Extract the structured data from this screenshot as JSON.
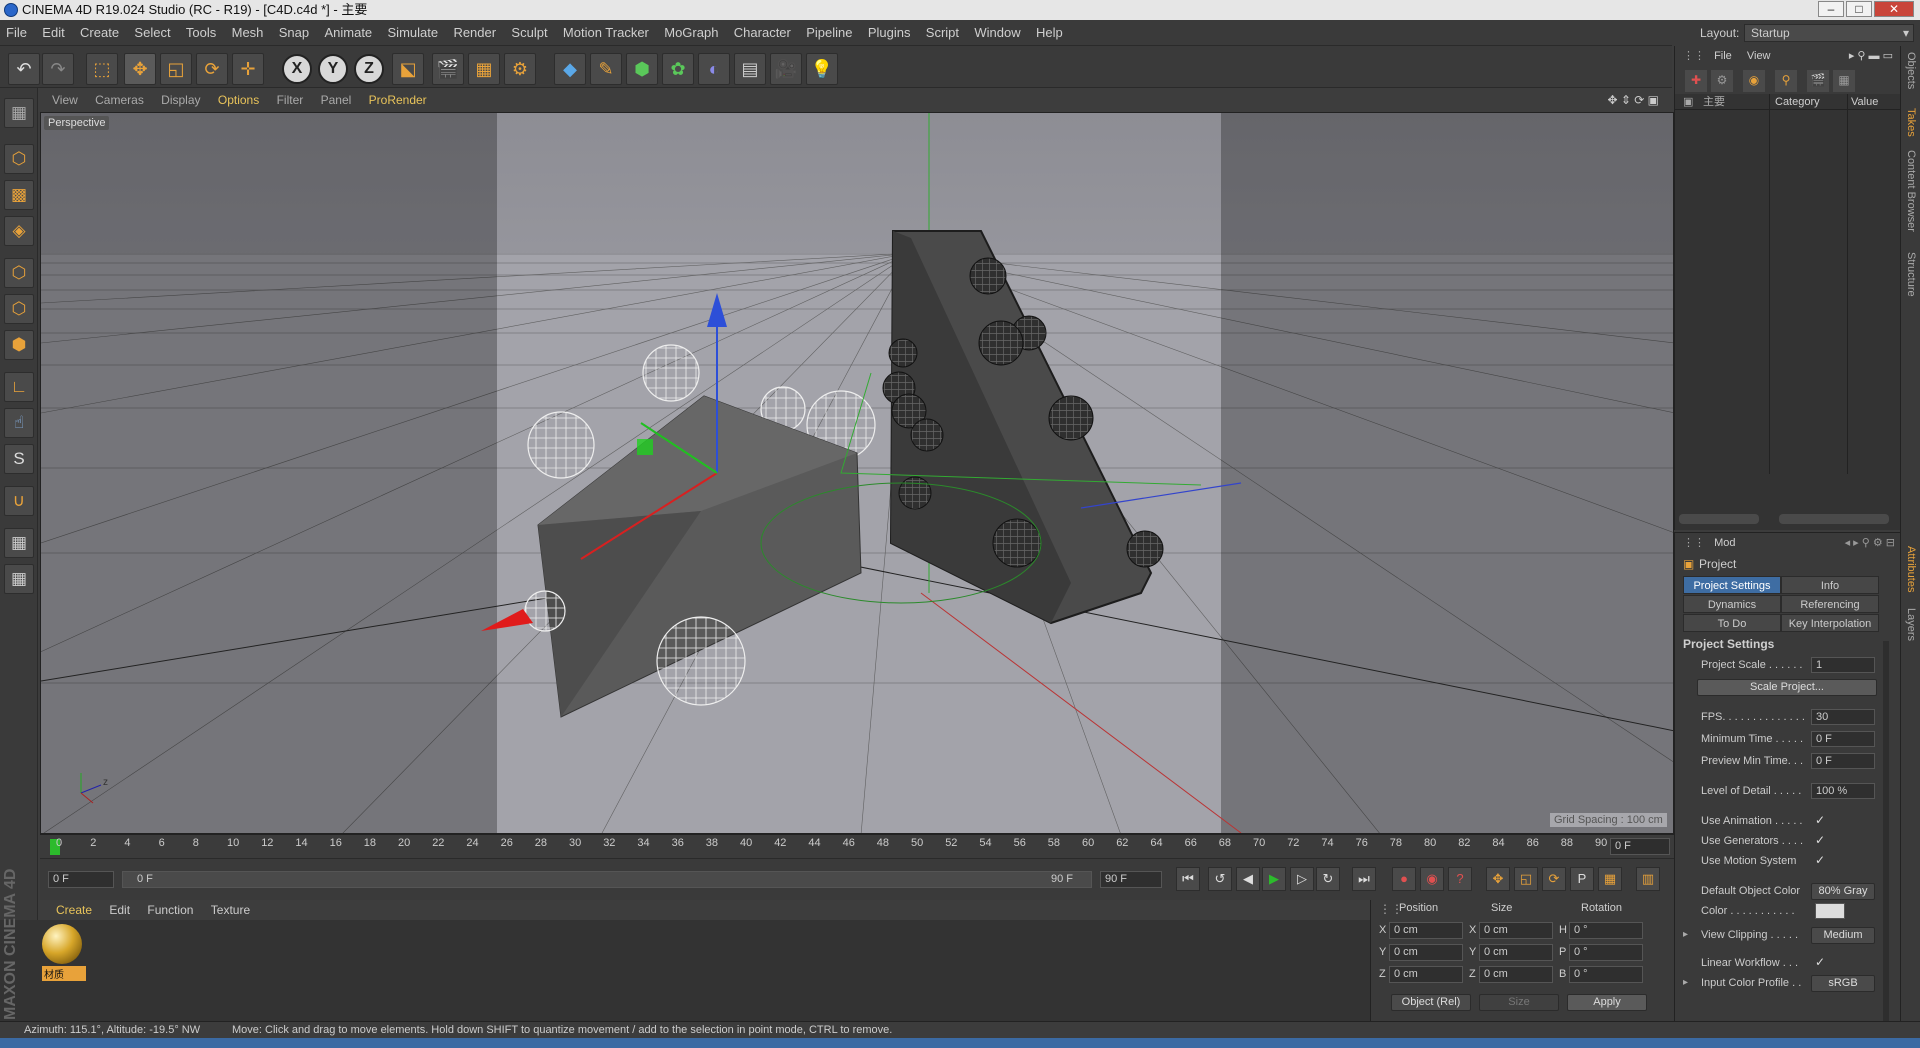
{
  "window": {
    "title": "CINEMA 4D R19.024 Studio (RC - R19) - [C4D.c4d *] - 主要"
  },
  "menu": [
    "File",
    "Edit",
    "Create",
    "Select",
    "Tools",
    "Mesh",
    "Snap",
    "Animate",
    "Simulate",
    "Render",
    "Sculpt",
    "Motion Tracker",
    "MoGraph",
    "Character",
    "Pipeline",
    "Plugins",
    "Script",
    "Window",
    "Help"
  ],
  "layout": {
    "label": "Layout:",
    "value": "Startup"
  },
  "toolbar": {
    "axis_x": "X",
    "axis_y": "Y",
    "axis_z": "Z"
  },
  "viewport_menu": [
    "View",
    "Cameras",
    "Display",
    "Options",
    "Filter",
    "Panel",
    "ProRender"
  ],
  "viewport": {
    "name": "Perspective",
    "grid_spacing": "Grid Spacing : 100 cm"
  },
  "timeline": {
    "ticks": [
      "0",
      "2",
      "4",
      "6",
      "8",
      "10",
      "12",
      "14",
      "16",
      "18",
      "20",
      "22",
      "24",
      "26",
      "28",
      "30",
      "32",
      "34",
      "36",
      "38",
      "40",
      "42",
      "44",
      "46",
      "48",
      "50",
      "52",
      "54",
      "56",
      "58",
      "60",
      "62",
      "64",
      "66",
      "68",
      "70",
      "72",
      "74",
      "76",
      "78",
      "80",
      "82",
      "84",
      "86",
      "88",
      "90"
    ],
    "current": "0 F",
    "start": "0 F",
    "slider_start": "0 F",
    "slider_end": "90 F",
    "end": "90 F"
  },
  "material_menu": [
    "Create",
    "Edit",
    "Function",
    "Texture"
  ],
  "material": {
    "name": "材质"
  },
  "coords": {
    "headers": [
      "Position",
      "Size",
      "Rotation"
    ],
    "rows": [
      {
        "axis": "X",
        "pos": "0 cm",
        "saxis": "X",
        "size": "0 cm",
        "raxis": "H",
        "rot": "0 °"
      },
      {
        "axis": "Y",
        "pos": "0 cm",
        "saxis": "Y",
        "size": "0 cm",
        "raxis": "P",
        "rot": "0 °"
      },
      {
        "axis": "Z",
        "pos": "0 cm",
        "saxis": "Z",
        "size": "0 cm",
        "raxis": "B",
        "rot": "0 °"
      }
    ],
    "mode": "Object (Rel)",
    "size_mode": "Size",
    "apply": "Apply"
  },
  "objects_panel": {
    "menu": [
      "File",
      "View"
    ],
    "col_name": "主要",
    "col_category": "Category",
    "col_value": "Value"
  },
  "attributes": {
    "mode": "Mod",
    "title": "Project",
    "tabs": [
      "Project Settings",
      "Info",
      "Dynamics",
      "Referencing",
      "To Do",
      "Key Interpolation"
    ],
    "section": "Project Settings",
    "project_scale_label": "Project Scale . . . . . .",
    "project_scale": "1",
    "scale_project": "Scale Project...",
    "fps_label": "FPS. . . . . . . . . . . . . .",
    "fps": "30",
    "min_time_label": "Minimum Time . . . . .",
    "min_time": "0 F",
    "preview_min_label": "Preview Min Time. . .",
    "preview_min": "0 F",
    "lod_label": "Level of Detail . . . . .",
    "lod": "100 %",
    "use_animation": "Use Animation . . . . .",
    "use_generators": "Use Generators . . . .",
    "use_motion": "Use Motion System",
    "check": "✓",
    "default_color_label": "Default Object Color",
    "default_color": "80% Gray",
    "color_label": "Color . . . . . . . . . . .",
    "view_clipping_label": "View Clipping . . . . .",
    "view_clipping": "Medium",
    "linear_workflow": "Linear Workflow . . .",
    "input_profile_label": "Input Color Profile . .",
    "input_profile": "sRGB"
  },
  "side_tabs": [
    "Objects",
    "Takes",
    "Content Browser",
    "Structure",
    "Attributes",
    "Layers"
  ],
  "status": {
    "left": "Azimuth: 115.1°, Altitude: -19.5°  NW",
    "message": "Move: Click and drag to move elements. Hold down SHIFT to quantize movement / add to the selection in point mode, CTRL to remove."
  },
  "branding": "MAXON CINEMA 4D"
}
